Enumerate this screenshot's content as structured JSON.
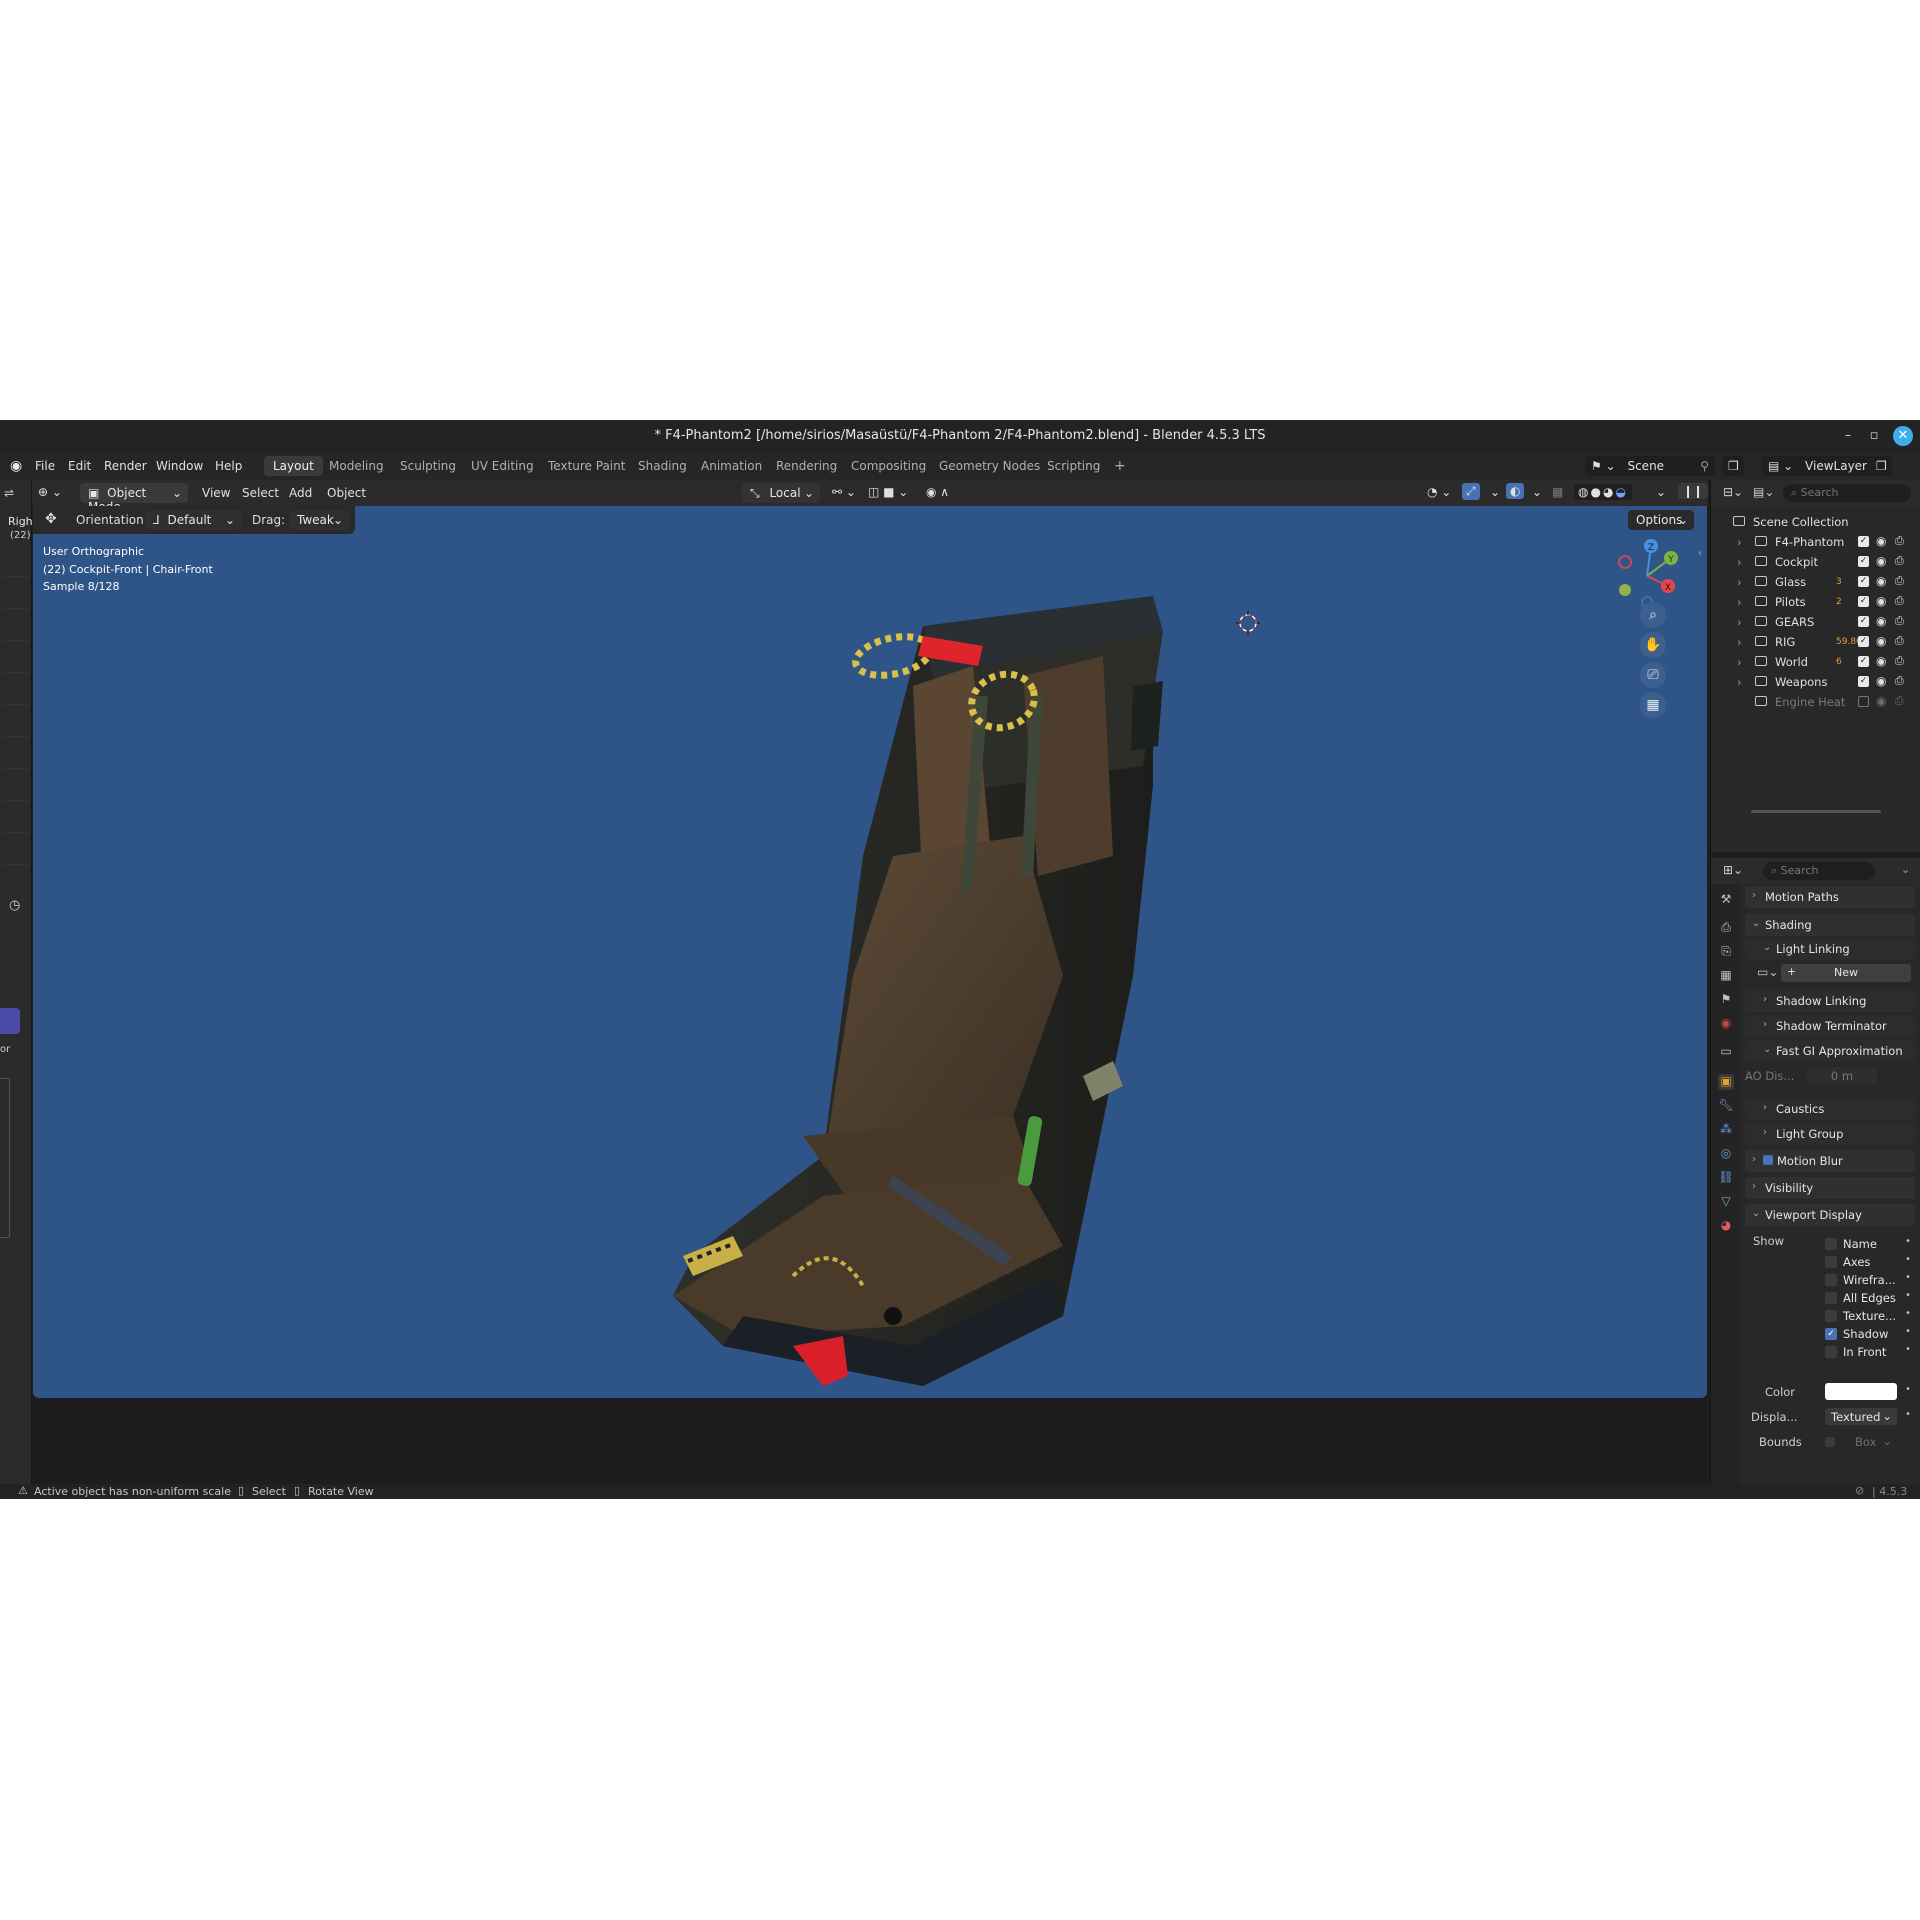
{
  "window": {
    "title": "* F4-Phantom2 [/home/sirios/Masaüstü/F4-Phantom 2/F4-Phantom2.blend] - Blender 4.5.3 LTS"
  },
  "menu": [
    "File",
    "Edit",
    "Render",
    "Window",
    "Help"
  ],
  "workspaces": [
    "Layout",
    "Modeling",
    "Sculpting",
    "UV Editing",
    "Texture Paint",
    "Shading",
    "Animation",
    "Rendering",
    "Compositing",
    "Geometry Nodes",
    "Scripting"
  ],
  "active_workspace": "Layout",
  "scene": {
    "name": "Scene",
    "view_layer": "ViewLayer"
  },
  "viewport_header": {
    "mode": "Object Mode",
    "menus": [
      "View",
      "Select",
      "Add",
      "Object"
    ],
    "transform": "Local",
    "orientation_label": "Orientation:",
    "orientation": "Default",
    "drag_label": "Drag:",
    "drag": "Tweak",
    "options": "Options"
  },
  "viewport_overlay": {
    "view_name": "User Orthographic",
    "object_info": "(22) Cockpit-Front | Chair-Front",
    "sample": "Sample 8/128"
  },
  "gizmo": {
    "x": "X",
    "y": "Y",
    "z": "Z"
  },
  "left_strip": {
    "label1": "Righ",
    "label2": "(22)",
    "label3": "or"
  },
  "outliner": {
    "search_placeholder": "Search",
    "root": "Scene Collection",
    "items": [
      {
        "name": "F4-Phantom",
        "badge": ""
      },
      {
        "name": "Cockpit",
        "badge": ""
      },
      {
        "name": "Glass",
        "badge": "3"
      },
      {
        "name": "Pilots",
        "badge": "2"
      },
      {
        "name": "GEARS",
        "badge": ""
      },
      {
        "name": "RIG",
        "badge": "59.86"
      },
      {
        "name": "World",
        "badge": "6"
      },
      {
        "name": "Weapons",
        "badge": ""
      },
      {
        "name": "Engine Heat",
        "badge": ""
      }
    ]
  },
  "properties": {
    "search_placeholder": "Search",
    "motion_paths": "Motion Paths",
    "shading": "Shading",
    "light_linking": "Light Linking",
    "new_button": "New",
    "shadow_linking": "Shadow Linking",
    "shadow_terminator": "Shadow Terminator",
    "fast_gi": "Fast GI Approximation",
    "ao_label": "AO Dis...",
    "ao_value": "0 m",
    "caustics": "Caustics",
    "light_group": "Light Group",
    "motion_blur": "Motion Blur",
    "visibility": "Visibility",
    "viewport_display": "Viewport Display",
    "show_label": "Show",
    "show_items": [
      {
        "label": "Name",
        "checked": false
      },
      {
        "label": "Axes",
        "checked": false
      },
      {
        "label": "Wirefra...",
        "checked": false
      },
      {
        "label": "All Edges",
        "checked": false
      },
      {
        "label": "Texture...",
        "checked": false
      },
      {
        "label": "Shadow",
        "checked": true
      },
      {
        "label": "In Front",
        "checked": false
      }
    ],
    "color_label": "Color",
    "display_label": "Displa...",
    "display_value": "Textured",
    "bounds_label": "Bounds",
    "bounds_value": "Box"
  },
  "statusbar": {
    "message": "Active object has non-uniform scale",
    "hint1": "Select",
    "hint2": "Rotate View",
    "version": "4.5.3"
  },
  "colors": {
    "viewport_bg": "#2f5588",
    "accent": "#4772b3",
    "brand": "#3daee9"
  }
}
